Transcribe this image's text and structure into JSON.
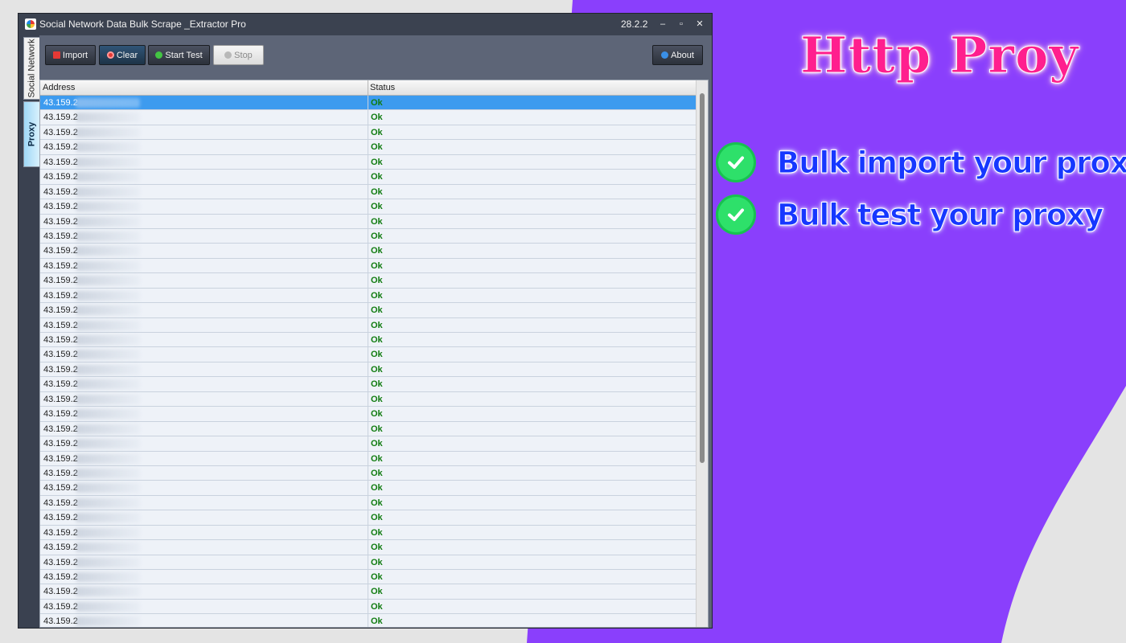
{
  "window": {
    "title": "Social Network Data Bulk Scrape _Extractor Pro",
    "version": "28.2.2",
    "controls": {
      "minimize": "‒",
      "maximize": "▫",
      "close": "✕"
    }
  },
  "sidetabs": {
    "social": "Social Network",
    "proxy": "Proxy"
  },
  "toolbar": {
    "import_label": "Import",
    "clear_label": "Clear",
    "start_test_label": "Start Test",
    "stop_label": "Stop",
    "about_label": "About"
  },
  "grid": {
    "columns": {
      "address": "Address",
      "status": "Status"
    },
    "rows": [
      {
        "address": "43.159.2",
        "status": "Ok"
      },
      {
        "address": "43.159.2",
        "status": "Ok"
      },
      {
        "address": "43.159.2",
        "status": "Ok"
      },
      {
        "address": "43.159.2",
        "status": "Ok"
      },
      {
        "address": "43.159.2",
        "status": "Ok"
      },
      {
        "address": "43.159.2",
        "status": "Ok"
      },
      {
        "address": "43.159.2",
        "status": "Ok"
      },
      {
        "address": "43.159.2",
        "status": "Ok"
      },
      {
        "address": "43.159.2",
        "status": "Ok"
      },
      {
        "address": "43.159.2",
        "status": "Ok"
      },
      {
        "address": "43.159.2",
        "status": "Ok"
      },
      {
        "address": "43.159.2",
        "status": "Ok"
      },
      {
        "address": "43.159.2",
        "status": "Ok"
      },
      {
        "address": "43.159.2",
        "status": "Ok"
      },
      {
        "address": "43.159.2",
        "status": "Ok"
      },
      {
        "address": "43.159.2",
        "status": "Ok"
      },
      {
        "address": "43.159.2",
        "status": "Ok"
      },
      {
        "address": "43.159.2",
        "status": "Ok"
      },
      {
        "address": "43.159.2",
        "status": "Ok"
      },
      {
        "address": "43.159.2",
        "status": "Ok"
      },
      {
        "address": "43.159.2",
        "status": "Ok"
      },
      {
        "address": "43.159.2",
        "status": "Ok"
      },
      {
        "address": "43.159.2",
        "status": "Ok"
      },
      {
        "address": "43.159.2",
        "status": "Ok"
      },
      {
        "address": "43.159.2",
        "status": "Ok"
      },
      {
        "address": "43.159.2",
        "status": "Ok"
      },
      {
        "address": "43.159.2",
        "status": "Ok"
      },
      {
        "address": "43.159.2",
        "status": "Ok"
      },
      {
        "address": "43.159.2",
        "status": "Ok"
      },
      {
        "address": "43.159.2",
        "status": "Ok"
      },
      {
        "address": "43.159.2",
        "status": "Ok"
      },
      {
        "address": "43.159.2",
        "status": "Ok"
      },
      {
        "address": "43.159.2",
        "status": "Ok"
      },
      {
        "address": "43.159.2",
        "status": "Ok"
      },
      {
        "address": "43.159.2",
        "status": "Ok"
      },
      {
        "address": "43.159.2",
        "status": "Ok"
      }
    ]
  },
  "promo": {
    "title": "Http Proy",
    "features": [
      "Bulk import your proxy",
      "Bulk test your proxy"
    ],
    "colors": {
      "purple": "#8a3ffc",
      "title": "#ff1f8e",
      "feature": "#1637ff",
      "check": "#2ee06a"
    }
  },
  "icons": [
    "app-logo-icon",
    "import-icon",
    "clear-icon",
    "start-test-icon",
    "stop-icon",
    "about-icon",
    "checkmark-icon"
  ]
}
